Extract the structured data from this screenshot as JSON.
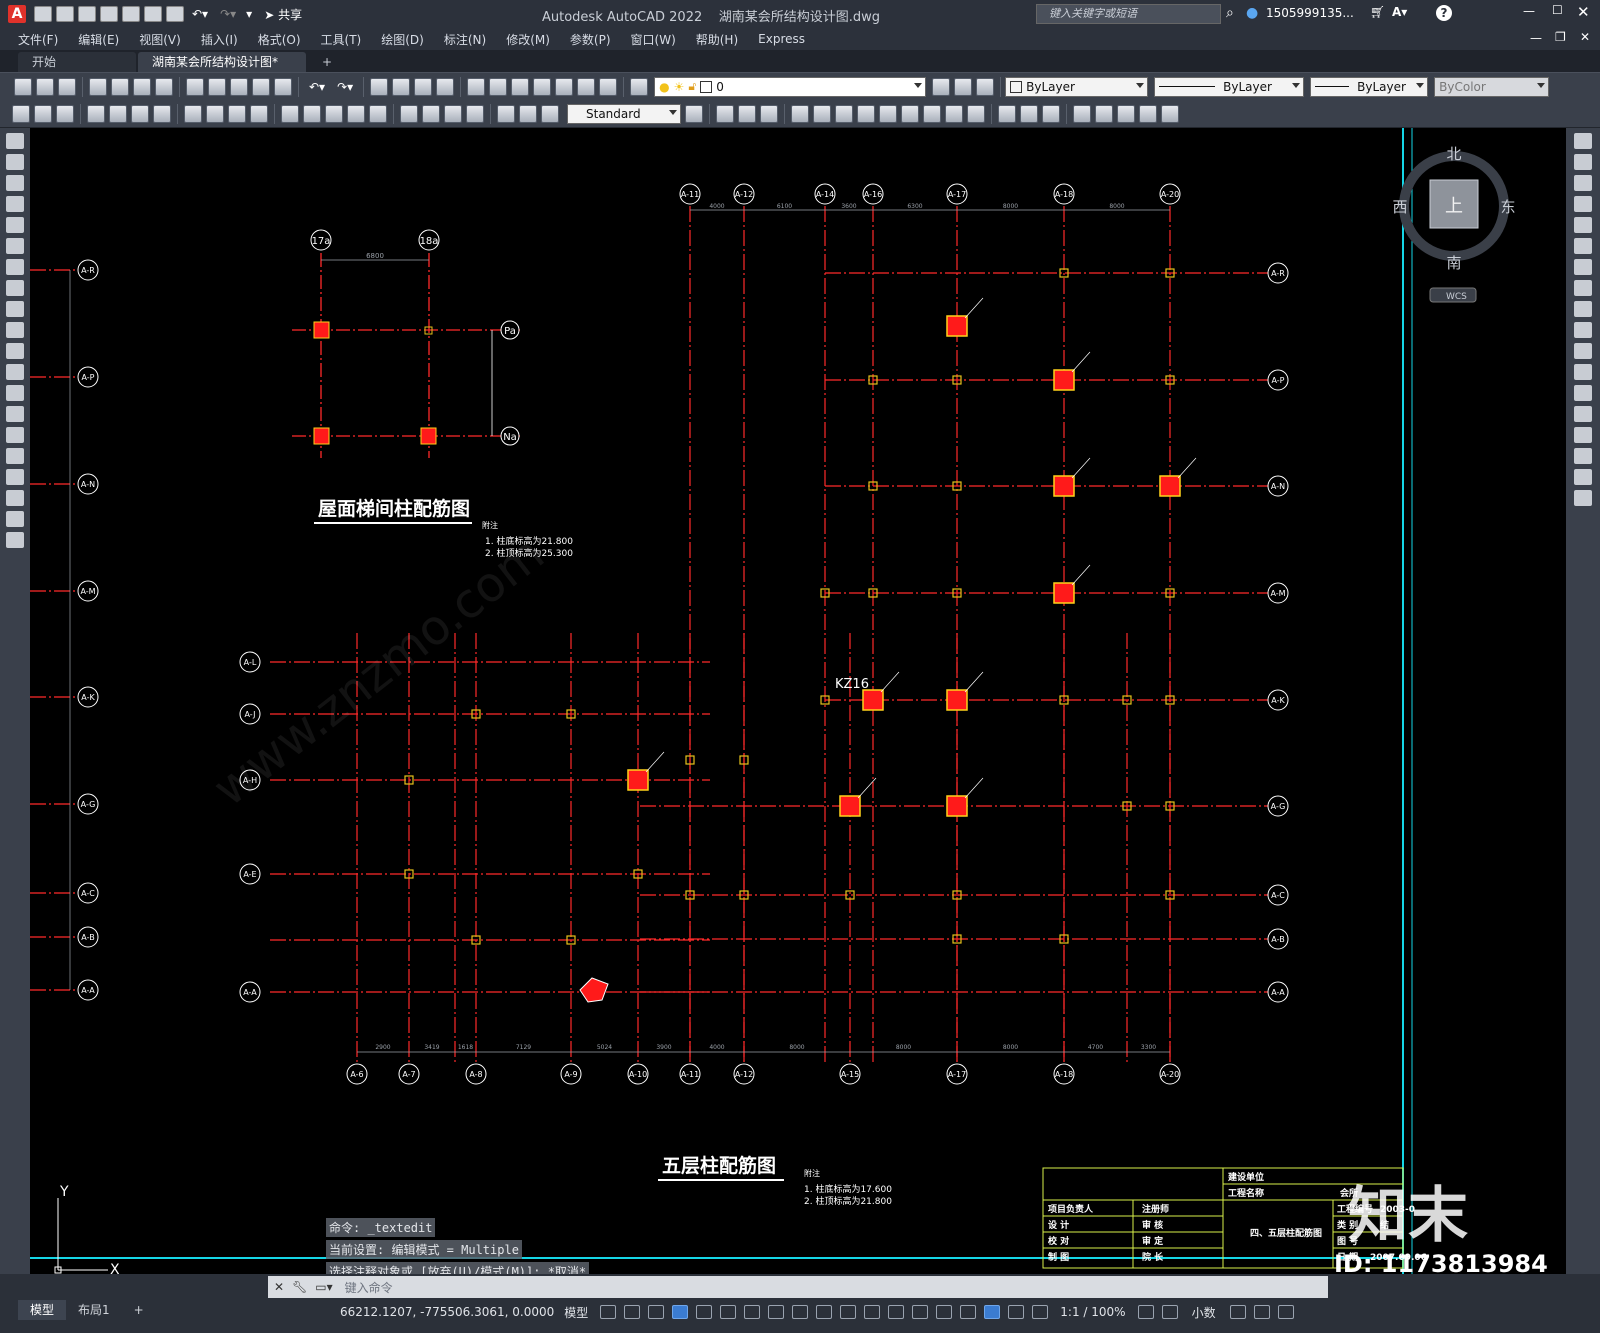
{
  "app": {
    "title": "Autodesk AutoCAD 2022    湖南某会所结构设计图.dwg",
    "share_label": "共享",
    "search_placeholder": "键入关键字或短语",
    "user": "1505999135...",
    "help": "?"
  },
  "menu": [
    "文件(F)",
    "编辑(E)",
    "视图(V)",
    "插入(I)",
    "格式(O)",
    "工具(T)",
    "绘图(D)",
    "标注(N)",
    "修改(M)",
    "参数(P)",
    "窗口(W)",
    "帮助(H)",
    "Express"
  ],
  "tabs": [
    "开始",
    "湖南某会所结构设计图*"
  ],
  "toolbar": {
    "layer_value": "0",
    "color_value": "ByLayer",
    "linetype_value": "ByLayer",
    "lineweight_value": "ByLayer",
    "plotstyle_value": "ByColor",
    "textstyle_value": "Standard"
  },
  "viewcube": {
    "north": "北",
    "south": "南",
    "east": "东",
    "west": "西",
    "top": "上",
    "wcs": "WCS"
  },
  "drawing": {
    "title_roof": "屋面梯间柱配筋图",
    "title_fifth": "五层柱配筋图",
    "notes_label": "附注",
    "roof_note_1": "1. 柱底标高为21.800",
    "roof_note_2": "2. 柱顶标高为25.300",
    "fifth_note_1": "1. 柱底标高为17.600",
    "fifth_note_2": "2. 柱顶标高为21.800",
    "kz_label": "KZ16",
    "ucs_y": "Y",
    "ucs_x": "X",
    "top_axes": [
      "A-11",
      "A-12",
      "A-14",
      "A-16",
      "A-17",
      "A-18",
      "A-20"
    ],
    "top_dims": [
      "4000",
      "6100",
      "3600",
      "6300",
      "8000",
      "8000"
    ],
    "bottom_axes": [
      "A-6",
      "A-7",
      "A-8",
      "A-9",
      "A-10",
      "A-11",
      "A-12",
      "A-15",
      "A-17",
      "A-18",
      "A-20"
    ],
    "bottom_dims": [
      "2900",
      "3419",
      "1618",
      "7129",
      "5024",
      "3900",
      "4000",
      "8000",
      "8000",
      "8000",
      "4700",
      "3300"
    ],
    "left_axes": [
      "A-R",
      "A-P",
      "A-N",
      "A-M",
      "A-K",
      "A-G",
      "A-C",
      "A-B",
      "A-A"
    ],
    "mid_axes": [
      "A-L",
      "A-J",
      "A-H",
      "A-E",
      "A-A"
    ],
    "roof_axes": [
      "17a",
      "18a",
      "Pa",
      "Na"
    ],
    "roof_dim": "6800"
  },
  "titleblock": {
    "row1": "建设单位",
    "row2": "工程名称",
    "proj_value": "会所",
    "left_labels": [
      "项目负责人",
      "设 计",
      "校 对",
      "制 图",
      "审 核"
    ],
    "mid_labels": [
      "注册师",
      "审 核",
      "审 定",
      "院 长"
    ],
    "sheet_title": "四、五层柱配筋图",
    "right_labels": [
      "工程编号",
      "类 别",
      "图 号",
      "日 期"
    ],
    "right_values": [
      "2003-0",
      "结",
      "",
      "2007.09.06"
    ]
  },
  "command": {
    "line1": "命令: _textedit",
    "line2": "当前设置: 编辑模式 = Multiple",
    "line3": "选择注释对象或 [放弃(U)/模式(M)]: *取消*",
    "input_placeholder": "键入命令"
  },
  "status": {
    "layout_tabs": [
      "模型",
      "布局1"
    ],
    "coords": "66212.1207, -775506.3061, 0.0000",
    "mode": "模型",
    "scale": "1:1 / 100%",
    "units": "小数"
  },
  "watermark": {
    "brand": "知末",
    "id": "ID: 1173813984",
    "site": "www.znzmo.com"
  },
  "colors": {
    "axis": "#ff2a2a",
    "column": "#ff1a1a",
    "dim": "#9aa0a8",
    "titleblock": "#d9f04a",
    "cyan": "#15d6e6"
  }
}
